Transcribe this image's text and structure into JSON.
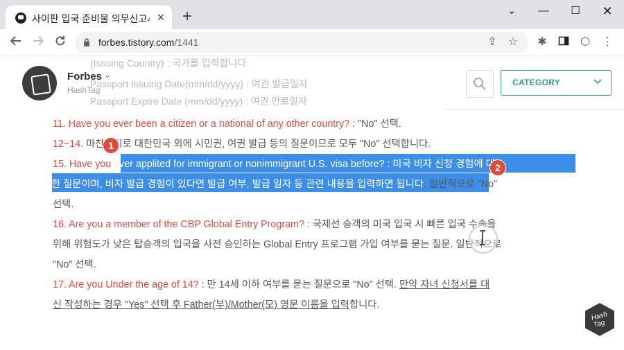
{
  "browser": {
    "tab_title": "사이판 입국 준비물 의무신고서(",
    "url_domain": "forbes.tistory.com",
    "url_path": "/1441"
  },
  "faded_behind": {
    "line1": "(Issuing Country) : 국가를 입력합니다",
    "line2": "Passport Issuing Date(mm/dd/yyyy) : 여권 발급일자",
    "line3": "Passport Expire Date (mm/dd/yyyy) : 여권 만료일자"
  },
  "site": {
    "brand": "Forbes",
    "tag": "HashTag",
    "category_label": "CATEGORY",
    "accent_color": "#2d9c8f"
  },
  "article": {
    "q11_red": "11. Have you ever been a citizen or a national of any other country?",
    "q11_rest": " : \"No\" 선택.",
    "q12_red": "12~14.",
    "q12_rest": " 마찬가지로 대한민국 외에 시민권, 여권 발급 등의 질문이므로 모두 \"No\" 선택합니다.",
    "q15_red_a": "15. Have you",
    "q15_sel_1": " ever applited for immigrant or nonimmigrant U.S. visa before?",
    "q15_sel_2": " : 미국 비자 신청 경험에 대",
    "q15_line2_sel": "한 질문이며, 비자 발급 경험이 있다면 발급 여부, 발급 일자 등 관련 내용을 입력하면 됩니다",
    "q15_line2_rest": ". 일반적으로 \"No\"",
    "q15_line3": "선택.",
    "q16_red": "16. Are you a member of the CBP Global Entry Program?",
    "q16_rest": " : 국제선 승객의 미국 입국 시 빠른 입국 수속을",
    "q16_line2": "위해 위험도가 낮은 탑승객의 입국을 사전 승인하는 Global Entry 프로그램 가입 여부를 묻는 질문. 일반적으로",
    "q16_line3": "\"No\" 선택.",
    "q17_red": "17. Are you Under the age of 14?",
    "q17_rest": " : 만 14세 이하 여부를 묻는 질문으로 \"No\" 선택. ",
    "q17_ul": "만약 자녀 신청서를 대",
    "q17_line2_ul": "신 작성하는 경우 \"Yes\" 선택 후 Father(부)/Mother(모) 영문 이름을 입력",
    "q17_line2_rest": "합니다."
  },
  "annotations": {
    "badge1": "1",
    "badge2": "2"
  },
  "colors": {
    "question_red": "#e04a3c",
    "selection_blue": "#3d8ee8"
  }
}
